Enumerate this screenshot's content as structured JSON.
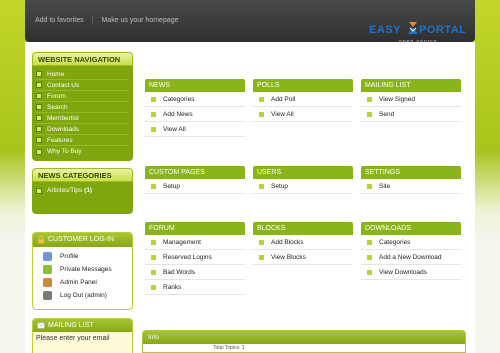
{
  "header": {
    "links": [
      "Add to favorites",
      "Make us your homepage"
    ],
    "logo": {
      "left": "EASY",
      "right": "PORTAL",
      "tagline": "open source"
    }
  },
  "sidebar": {
    "nav_title": "WEBSITE NAVIGATION",
    "nav_items": [
      "Home",
      "Contact Us",
      "Forum",
      "Search",
      "Memberlist",
      "Downloads",
      "Features",
      "Why To Buy"
    ],
    "cat_title": "NEWS CATEGORIES",
    "categories": [
      {
        "label": "Articles/Tips",
        "count": "(1)"
      }
    ],
    "login_title": "CUSTOMER LOG-IN",
    "login_items": [
      "Profile",
      "Private Messages",
      "Admin Panel",
      "Log Out (admin)"
    ],
    "mail_title": "MAILING LIST",
    "mail_placeholder": "Please enter your email"
  },
  "grid": {
    "news": {
      "title": "NEWS",
      "items": [
        "Categories",
        "Add News",
        "View All"
      ]
    },
    "polls": {
      "title": "POLLS",
      "items": [
        "Add Poll",
        "View All"
      ]
    },
    "mailing": {
      "title": "MAILING LIST",
      "items": [
        "View Signed",
        "Send"
      ]
    },
    "custom": {
      "title": "CUSTOM PAGES",
      "items": [
        "Setup"
      ]
    },
    "users": {
      "title": "USERS",
      "items": [
        "Setup"
      ]
    },
    "settings": {
      "title": "SETTINGS",
      "items": [
        "Site"
      ]
    },
    "forum": {
      "title": "FORUM",
      "items": [
        "Management",
        "Reserved Logins",
        "Bad Words",
        "Ranks"
      ]
    },
    "blocks": {
      "title": "BLOCKS",
      "items": [
        "Add Blocks",
        "View Blocks"
      ]
    },
    "downloads": {
      "title": "DOWNLOADS",
      "items": [
        "Categories",
        "Add a New Download",
        "View Downloads"
      ]
    }
  },
  "info": {
    "title": "Info",
    "line": "Total Topics: 1"
  },
  "colors": {
    "accent": "#8ab51a",
    "header_bg": "#333333",
    "logo_blue": "#1c73c9",
    "logo_orange": "#f08a1c"
  }
}
